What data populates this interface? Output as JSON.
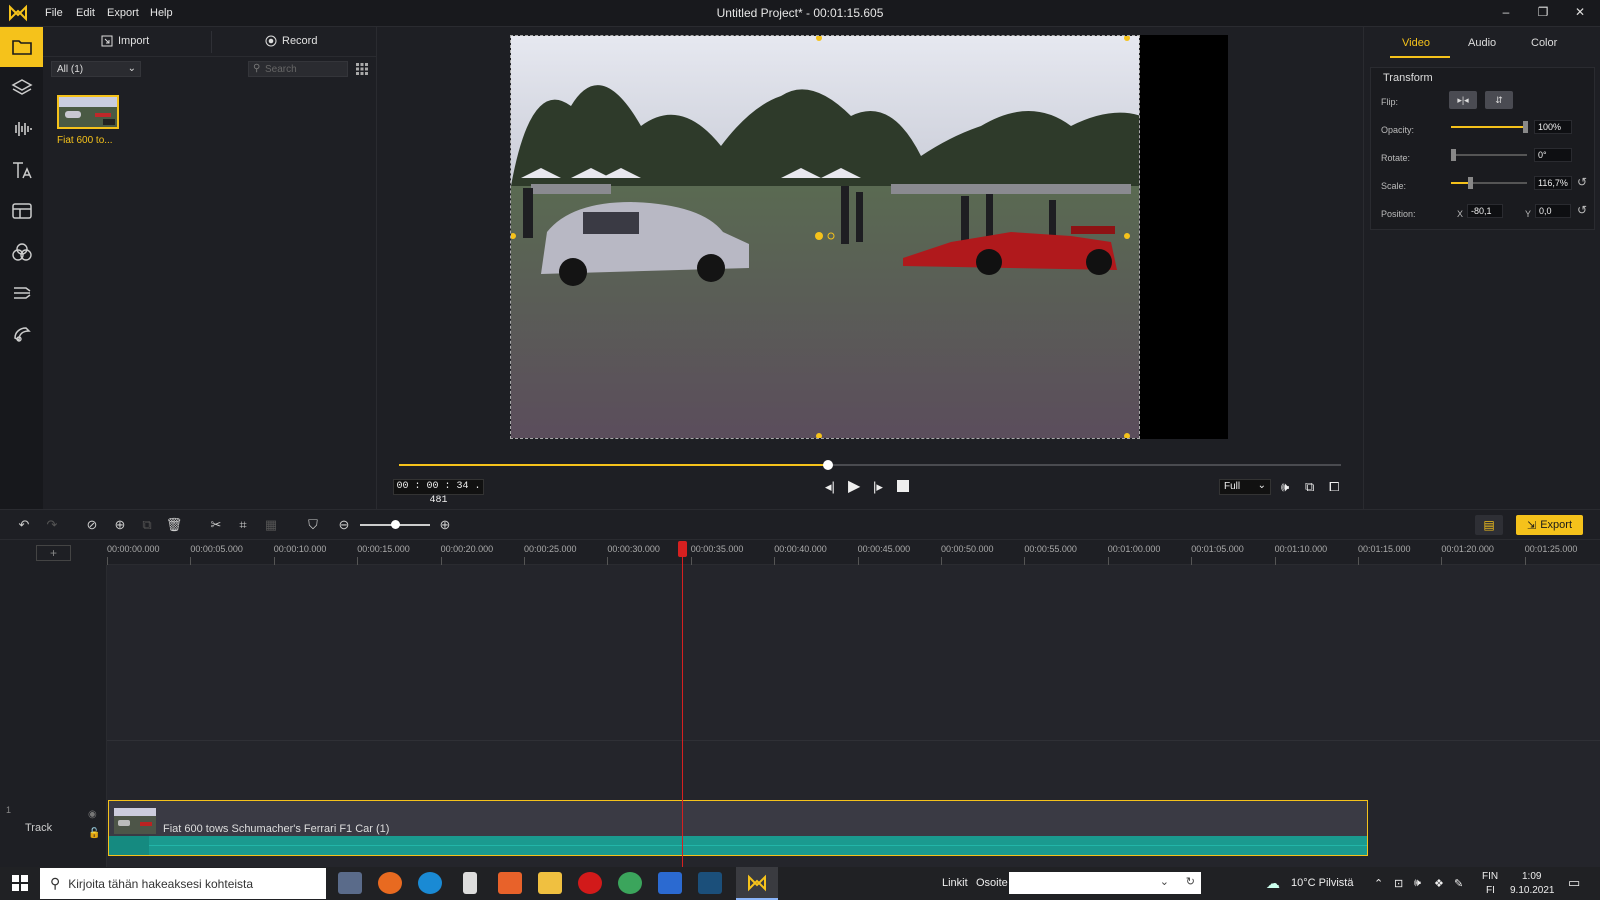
{
  "titlebar": {
    "menu": [
      "File",
      "Edit",
      "Export",
      "Help"
    ],
    "title": "Untitled Project* - 00:01:15.605"
  },
  "media": {
    "import_label": "Import",
    "record_label": "Record",
    "filter_value": "All (1)",
    "search_placeholder": "Search",
    "items": [
      {
        "label": "Fiat 600 to..."
      }
    ]
  },
  "preview": {
    "timecode": "00 : 00 : 34 . 481",
    "progress_fraction": 0.455,
    "zoom_value": "Full"
  },
  "props": {
    "tabs": [
      "Video",
      "Audio",
      "Color"
    ],
    "section_title": "Transform",
    "flip_label": "Flip:",
    "opacity_label": "Opacity:",
    "opacity_value": "100%",
    "opacity_fraction": 1.0,
    "rotate_label": "Rotate:",
    "rotate_value": "0°",
    "rotate_fraction": 0.0,
    "scale_label": "Scale:",
    "scale_value": "116,7%",
    "scale_fraction": 0.28,
    "position_label": "Position:",
    "pos_x_label": "X",
    "pos_x_value": "-80,1",
    "pos_y_label": "Y",
    "pos_y_value": "0,0"
  },
  "toolbar": {
    "export_label": "Export"
  },
  "ruler": {
    "ticks": [
      "00:00:00.000",
      "00:00:05.000",
      "00:00:10.000",
      "00:00:15.000",
      "00:00:20.000",
      "00:00:25.000",
      "00:00:30.000",
      "00:00:35.000",
      "00:00:40.000",
      "00:00:45.000",
      "00:00:50.000",
      "00:00:55.000",
      "00:01:00.000",
      "00:01:05.000",
      "00:01:10.000",
      "00:01:15.000",
      "00:01:20.000",
      "00:01:25.000"
    ]
  },
  "timeline": {
    "track_number": "1",
    "track_label": "Track",
    "clip_title": "Fiat 600 tows Schumacher's Ferrari F1 Car (1)"
  },
  "taskbar": {
    "search_placeholder": "Kirjoita tähän hakeaksesi kohteista",
    "links_label": "Linkit",
    "address_label": "Osoite",
    "weather": "10°C  Pilvistä",
    "lang_top": "FIN",
    "lang_bottom": "FI",
    "time": "1:09",
    "date": "9.10.2021"
  },
  "colors": {
    "accent": "#f5c21b",
    "playhead": "#d62020",
    "wave": "#1a9a8f"
  }
}
